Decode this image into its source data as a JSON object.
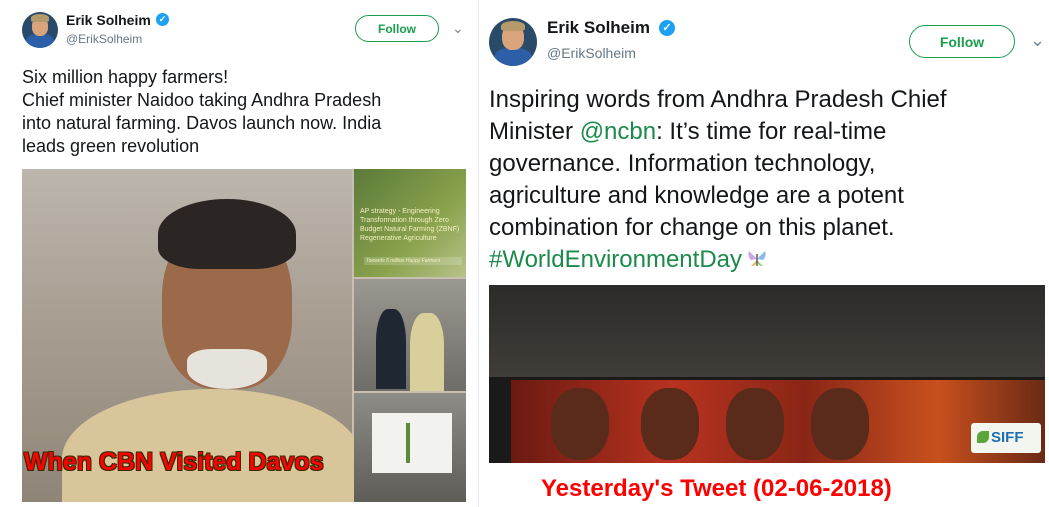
{
  "colors": {
    "follow_green": "#1b9e4b",
    "verified_blue": "#1da1f2",
    "link_green": "#1b8a4a",
    "caption_red": "#ff0000",
    "text_dark": "#14171a",
    "handle_gray": "#657786"
  },
  "tweet_left": {
    "author_name": "Erik Solheim",
    "verified_icon": "verified-badge-icon",
    "handle": "@ErikSolheim",
    "follow_label": "Follow",
    "chevron_icon": "chevron-down-icon",
    "text": "Six million happy farmers!\nChief minister Naidoo taking Andhra Pradesh\ninto natural farming. Davos launch now. India\nleads green revolution",
    "media": {
      "slide_text": "AP strategy - Engineering\nTransformation through Zero\nBudget Natural Farming (ZBNF)\nRegenerative Agriculture",
      "slide_subtitle": "Towards 6 million Happy Farmers"
    },
    "caption": "When CBN Visited Davos"
  },
  "tweet_right": {
    "author_name": "Erik Solheim",
    "verified_icon": "verified-badge-icon",
    "handle": "@ErikSolheim",
    "follow_label": "Follow",
    "chevron_icon": "chevron-down-icon",
    "text_before": "Inspiring words from Andhra Pradesh Chief\nMinister ",
    "mention": "@ncbn",
    "text_after": ": It’s time for real-time\ngovernance. Information technology,\nagriculture and knowledge are a potent\ncombination for change on this planet.\n",
    "hashtag": "#WorldEnvironmentDay",
    "emoji_icon": "butterfly-icon",
    "media": {
      "badge": "SIFF"
    },
    "caption": "Yesterday's Tweet (02-06-2018)"
  }
}
